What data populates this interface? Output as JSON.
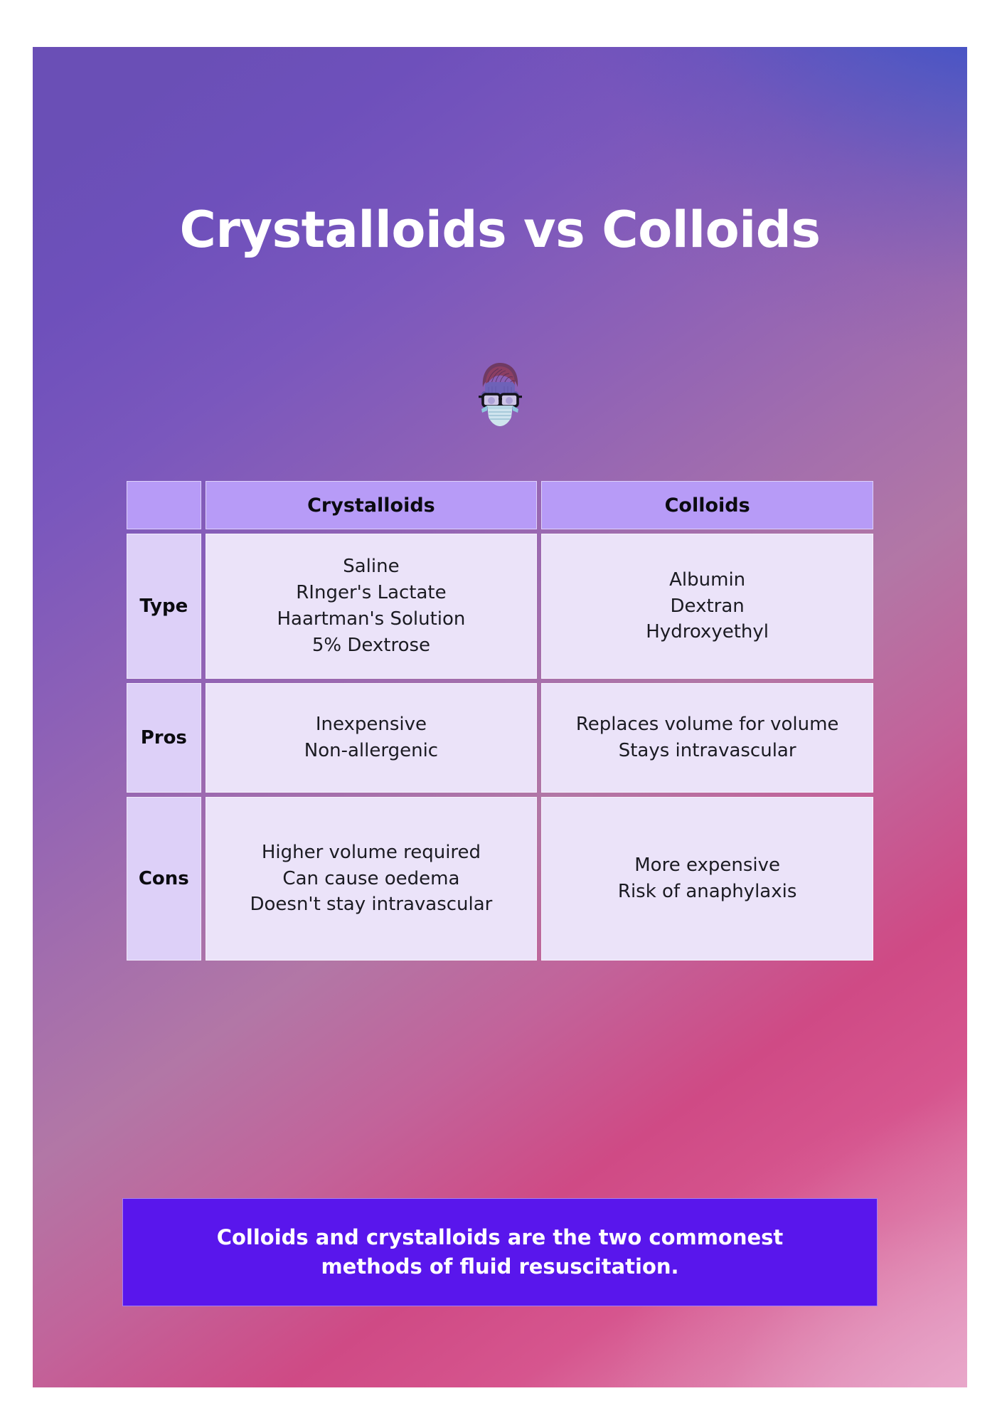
{
  "poster": {
    "title": "Crystalloids vs Colloids",
    "avatar_icon": "doctor-face-mask-icon",
    "colors": {
      "gradient_top_left": "#6a4fb6",
      "gradient_top_right": "#3551c4",
      "gradient_bottom_left": "#d1467f",
      "gradient_bottom_right": "#e7a9cb",
      "header_cell": "#b79bf7",
      "row_label_cell": "#ddd0f8",
      "content_cell": "#ebe3f9",
      "banner_background": "#5916ec",
      "title_text": "#ffffff",
      "banner_text": "#ffffff",
      "table_text": "#0b0b10"
    }
  },
  "table": {
    "columns": [
      "",
      "Crystalloids",
      "Colloids"
    ],
    "rows": [
      {
        "label": "Type",
        "crystalloids": [
          "Saline",
          "RInger's Lactate",
          "Haartman's Solution",
          "5% Dextrose"
        ],
        "colloids": [
          "Albumin",
          "Dextran",
          "Hydroxyethyl"
        ]
      },
      {
        "label": "Pros",
        "crystalloids": [
          "Inexpensive",
          "Non-allergenic"
        ],
        "colloids": [
          "Replaces volume for volume",
          "Stays intravascular"
        ]
      },
      {
        "label": "Cons",
        "crystalloids": [
          "Higher volume required",
          "Can cause oedema",
          "Doesn't stay intravascular"
        ],
        "colloids": [
          "More expensive",
          "Risk of anaphylaxis"
        ]
      }
    ]
  },
  "banner": {
    "text": "Colloids and crystalloids are the two commonest methods of fluid resuscitation."
  }
}
